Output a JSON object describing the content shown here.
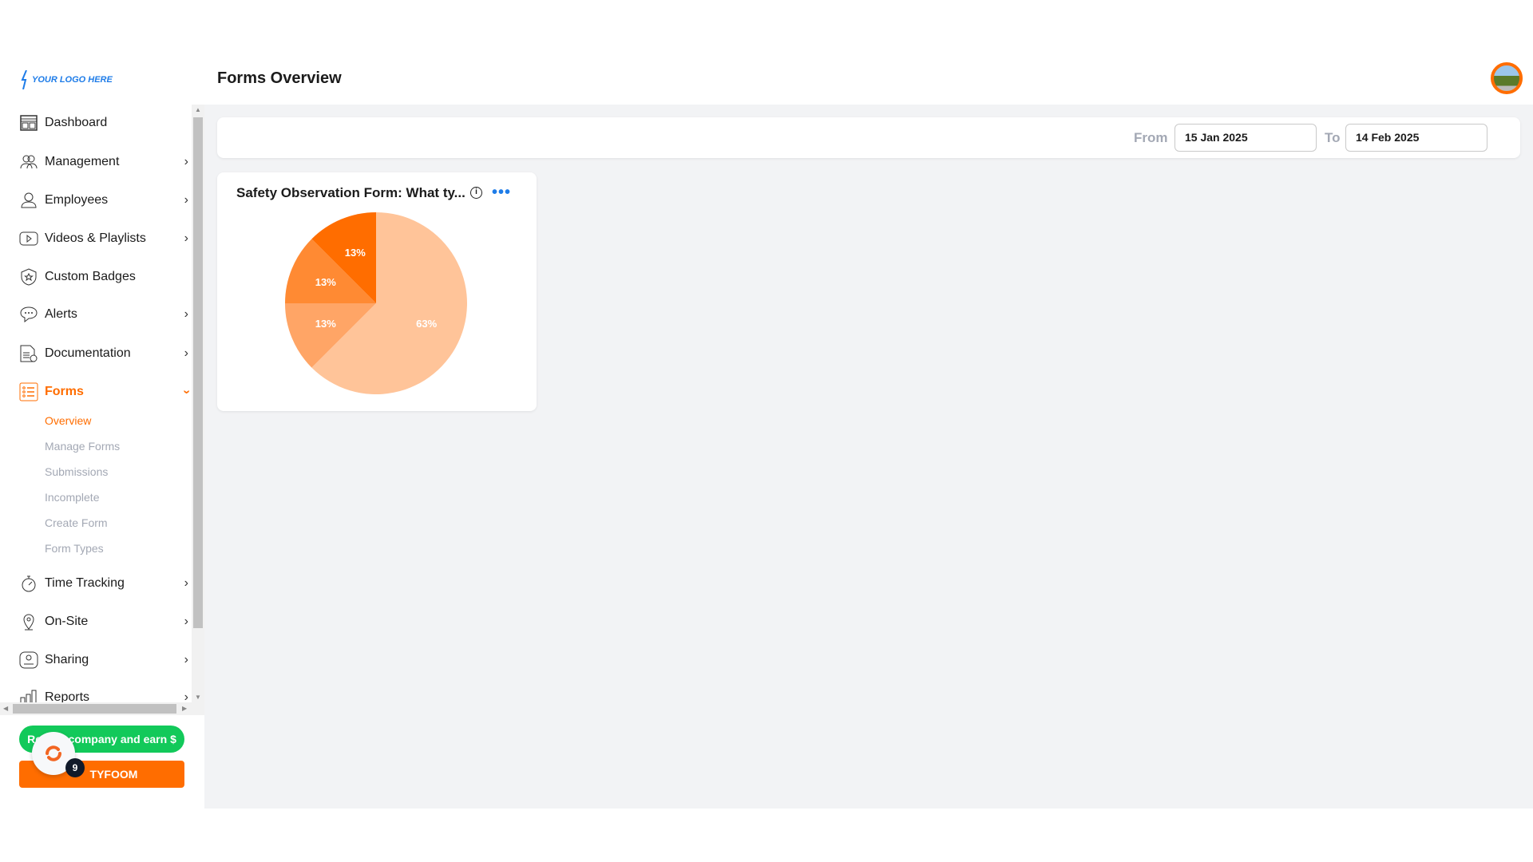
{
  "logo": {
    "text": "YOUR LOGO HERE"
  },
  "header": {
    "title": "Forms Overview"
  },
  "sidebar": {
    "items": [
      {
        "label": "Dashboard",
        "icon": "dashboard-icon"
      },
      {
        "label": "Management",
        "icon": "users-icon"
      },
      {
        "label": "Employees",
        "icon": "user-icon"
      },
      {
        "label": "Videos & Playlists",
        "icon": "play-icon"
      },
      {
        "label": "Custom Badges",
        "icon": "badge-icon"
      },
      {
        "label": "Alerts",
        "icon": "chat-icon"
      },
      {
        "label": "Documentation",
        "icon": "document-icon"
      },
      {
        "label": "Forms",
        "icon": "forms-icon",
        "active": true
      },
      {
        "label": "Time Tracking",
        "icon": "stopwatch-icon"
      },
      {
        "label": "On-Site",
        "icon": "location-icon"
      },
      {
        "label": "Sharing",
        "icon": "share-icon"
      },
      {
        "label": "Reports",
        "icon": "reports-icon"
      }
    ],
    "forms_sub": [
      "Overview",
      "Manage Forms",
      "Submissions",
      "Incomplete",
      "Create Form",
      "Form Types"
    ],
    "referral_label": "Refer a company and earn $",
    "brand_label": "TYFOOM",
    "notification_count": "9"
  },
  "filter": {
    "from_label": "From",
    "from_value": "15 Jan 2025",
    "to_label": "To",
    "to_value": "14 Feb 2025"
  },
  "colors": {
    "accent": "#ff6d00",
    "referral": "#12c95a",
    "link": "#1e7ce8"
  },
  "chart_data": {
    "type": "pie",
    "title": "Safety Observation Form: What ty...",
    "slices": [
      {
        "value": 62.5,
        "label": "63%",
        "color": "#ffc499"
      },
      {
        "value": 12.5,
        "label": "13%",
        "color": "#ffa566"
      },
      {
        "value": 12.5,
        "label": "13%",
        "color": "#ff8a33"
      },
      {
        "value": 12.5,
        "label": "13%",
        "color": "#ff6d00"
      }
    ]
  }
}
